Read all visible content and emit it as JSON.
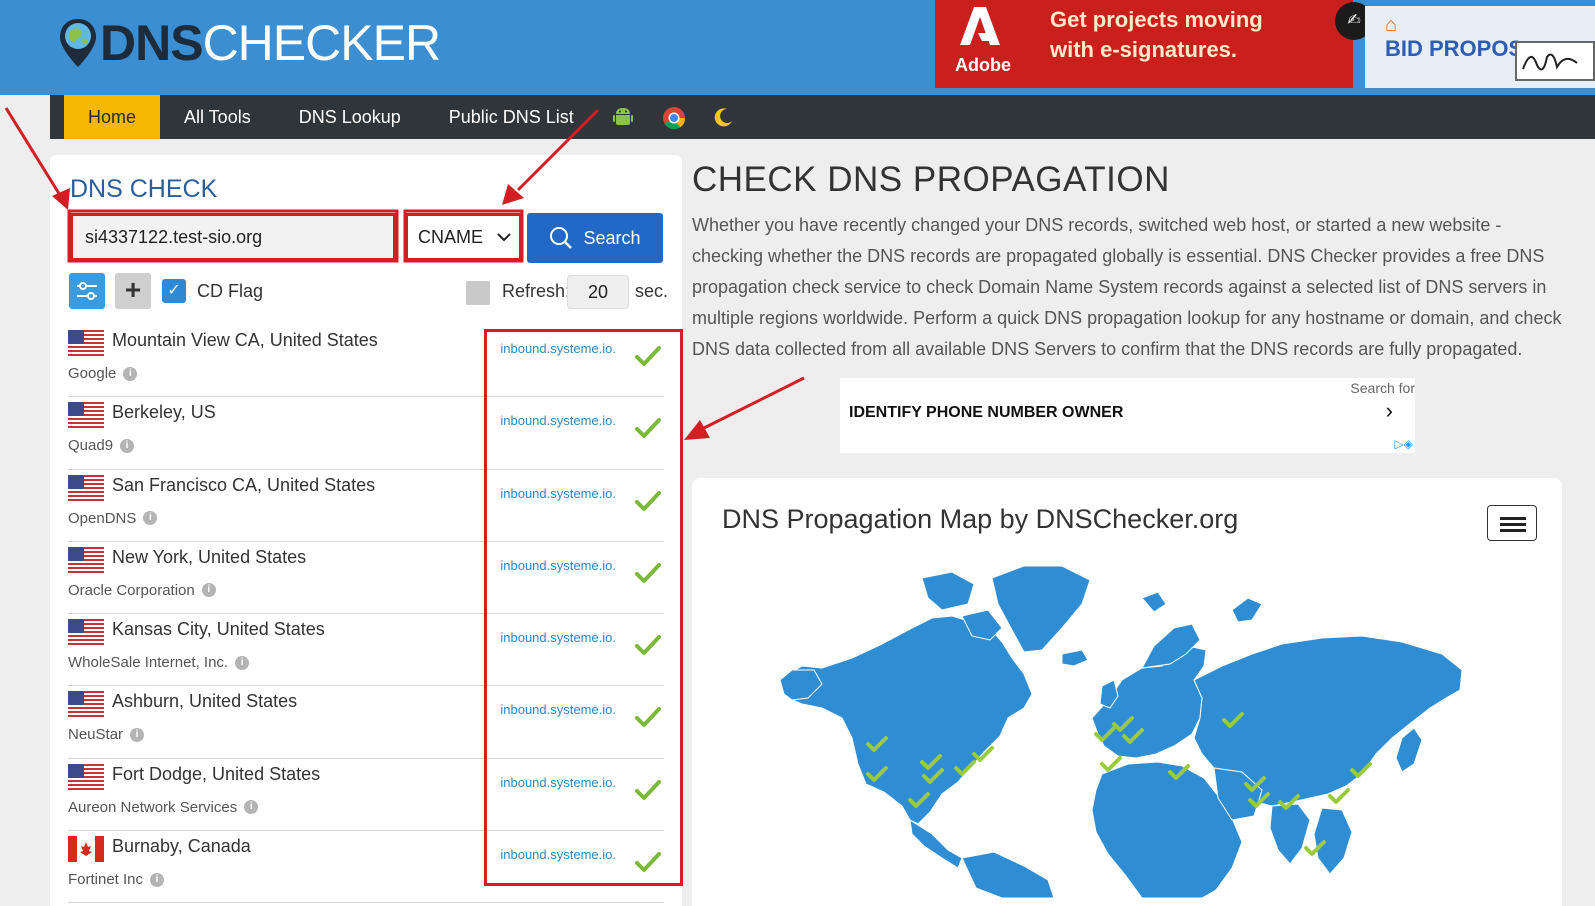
{
  "brand": {
    "part1": "DNS",
    "part2": "CHECKER"
  },
  "ad_banner": {
    "adobe_label": "Adobe",
    "headline_line1": "Get projects moving",
    "headline_line2": "with e-signatures.",
    "bid_text": "BID PROPOS"
  },
  "nav": {
    "items": [
      {
        "label": "Home",
        "active": true
      },
      {
        "label": "All Tools"
      },
      {
        "label": "DNS Lookup"
      },
      {
        "label": "Public DNS List"
      }
    ],
    "icons": [
      "android-icon",
      "chrome-icon",
      "moon-icon"
    ]
  },
  "check": {
    "title": "DNS CHECK",
    "domain_value": "si4337122.test-sio.org",
    "record_type": "CNAME",
    "search_label": "Search",
    "cd_flag_label": "CD Flag",
    "cd_flag_checked": true,
    "refresh_label": "Refresh:",
    "refresh_value": "20",
    "refresh_unit": "sec."
  },
  "results": [
    {
      "location": "Mountain View CA, United States",
      "provider": "Google",
      "country": "us",
      "value": "inbound.systeme.io.",
      "ok": true
    },
    {
      "location": "Berkeley, US",
      "provider": "Quad9",
      "country": "us",
      "value": "inbound.systeme.io.",
      "ok": true
    },
    {
      "location": "San Francisco CA, United States",
      "provider": "OpenDNS",
      "country": "us",
      "value": "inbound.systeme.io.",
      "ok": true
    },
    {
      "location": "New York, United States",
      "provider": "Oracle Corporation",
      "country": "us",
      "value": "inbound.systeme.io.",
      "ok": true
    },
    {
      "location": "Kansas City, United States",
      "provider": "WholeSale Internet, Inc.",
      "country": "us",
      "value": "inbound.systeme.io.",
      "ok": true
    },
    {
      "location": "Ashburn, United States",
      "provider": "NeuStar",
      "country": "us",
      "value": "inbound.systeme.io.",
      "ok": true
    },
    {
      "location": "Fort Dodge, United States",
      "provider": "Aureon Network Services",
      "country": "us",
      "value": "inbound.systeme.io.",
      "ok": true
    },
    {
      "location": "Burnaby, Canada",
      "provider": "Fortinet Inc",
      "country": "ca",
      "value": "inbound.systeme.io.",
      "ok": true
    }
  ],
  "page": {
    "title": "CHECK DNS PROPAGATION",
    "description": "Whether you have recently changed your DNS records, switched web host, or started a new website - checking whether the DNS records are propagated globally is essential. DNS Checker provides a free DNS propagation check service to check Domain Name System records against a selected list of DNS servers in multiple regions worldwide. Perform a quick DNS propagation lookup for any hostname or domain, and check DNS data collected from all available DNS Servers to confirm that the DNS records are fully propagated."
  },
  "ad_unit": {
    "search_for": "Search for",
    "query": "IDENTIFY PHONE NUMBER OWNER"
  },
  "map": {
    "title": "DNS Propagation Map by DNSChecker.org"
  },
  "colors": {
    "header": "#3b8ed2",
    "nav": "#2f3539",
    "active_tab": "#f5b700",
    "search_button": "#2168c7",
    "annotation_red": "#d31e24",
    "check_green": "#7cb83a",
    "map_land": "#2f8ed3"
  }
}
